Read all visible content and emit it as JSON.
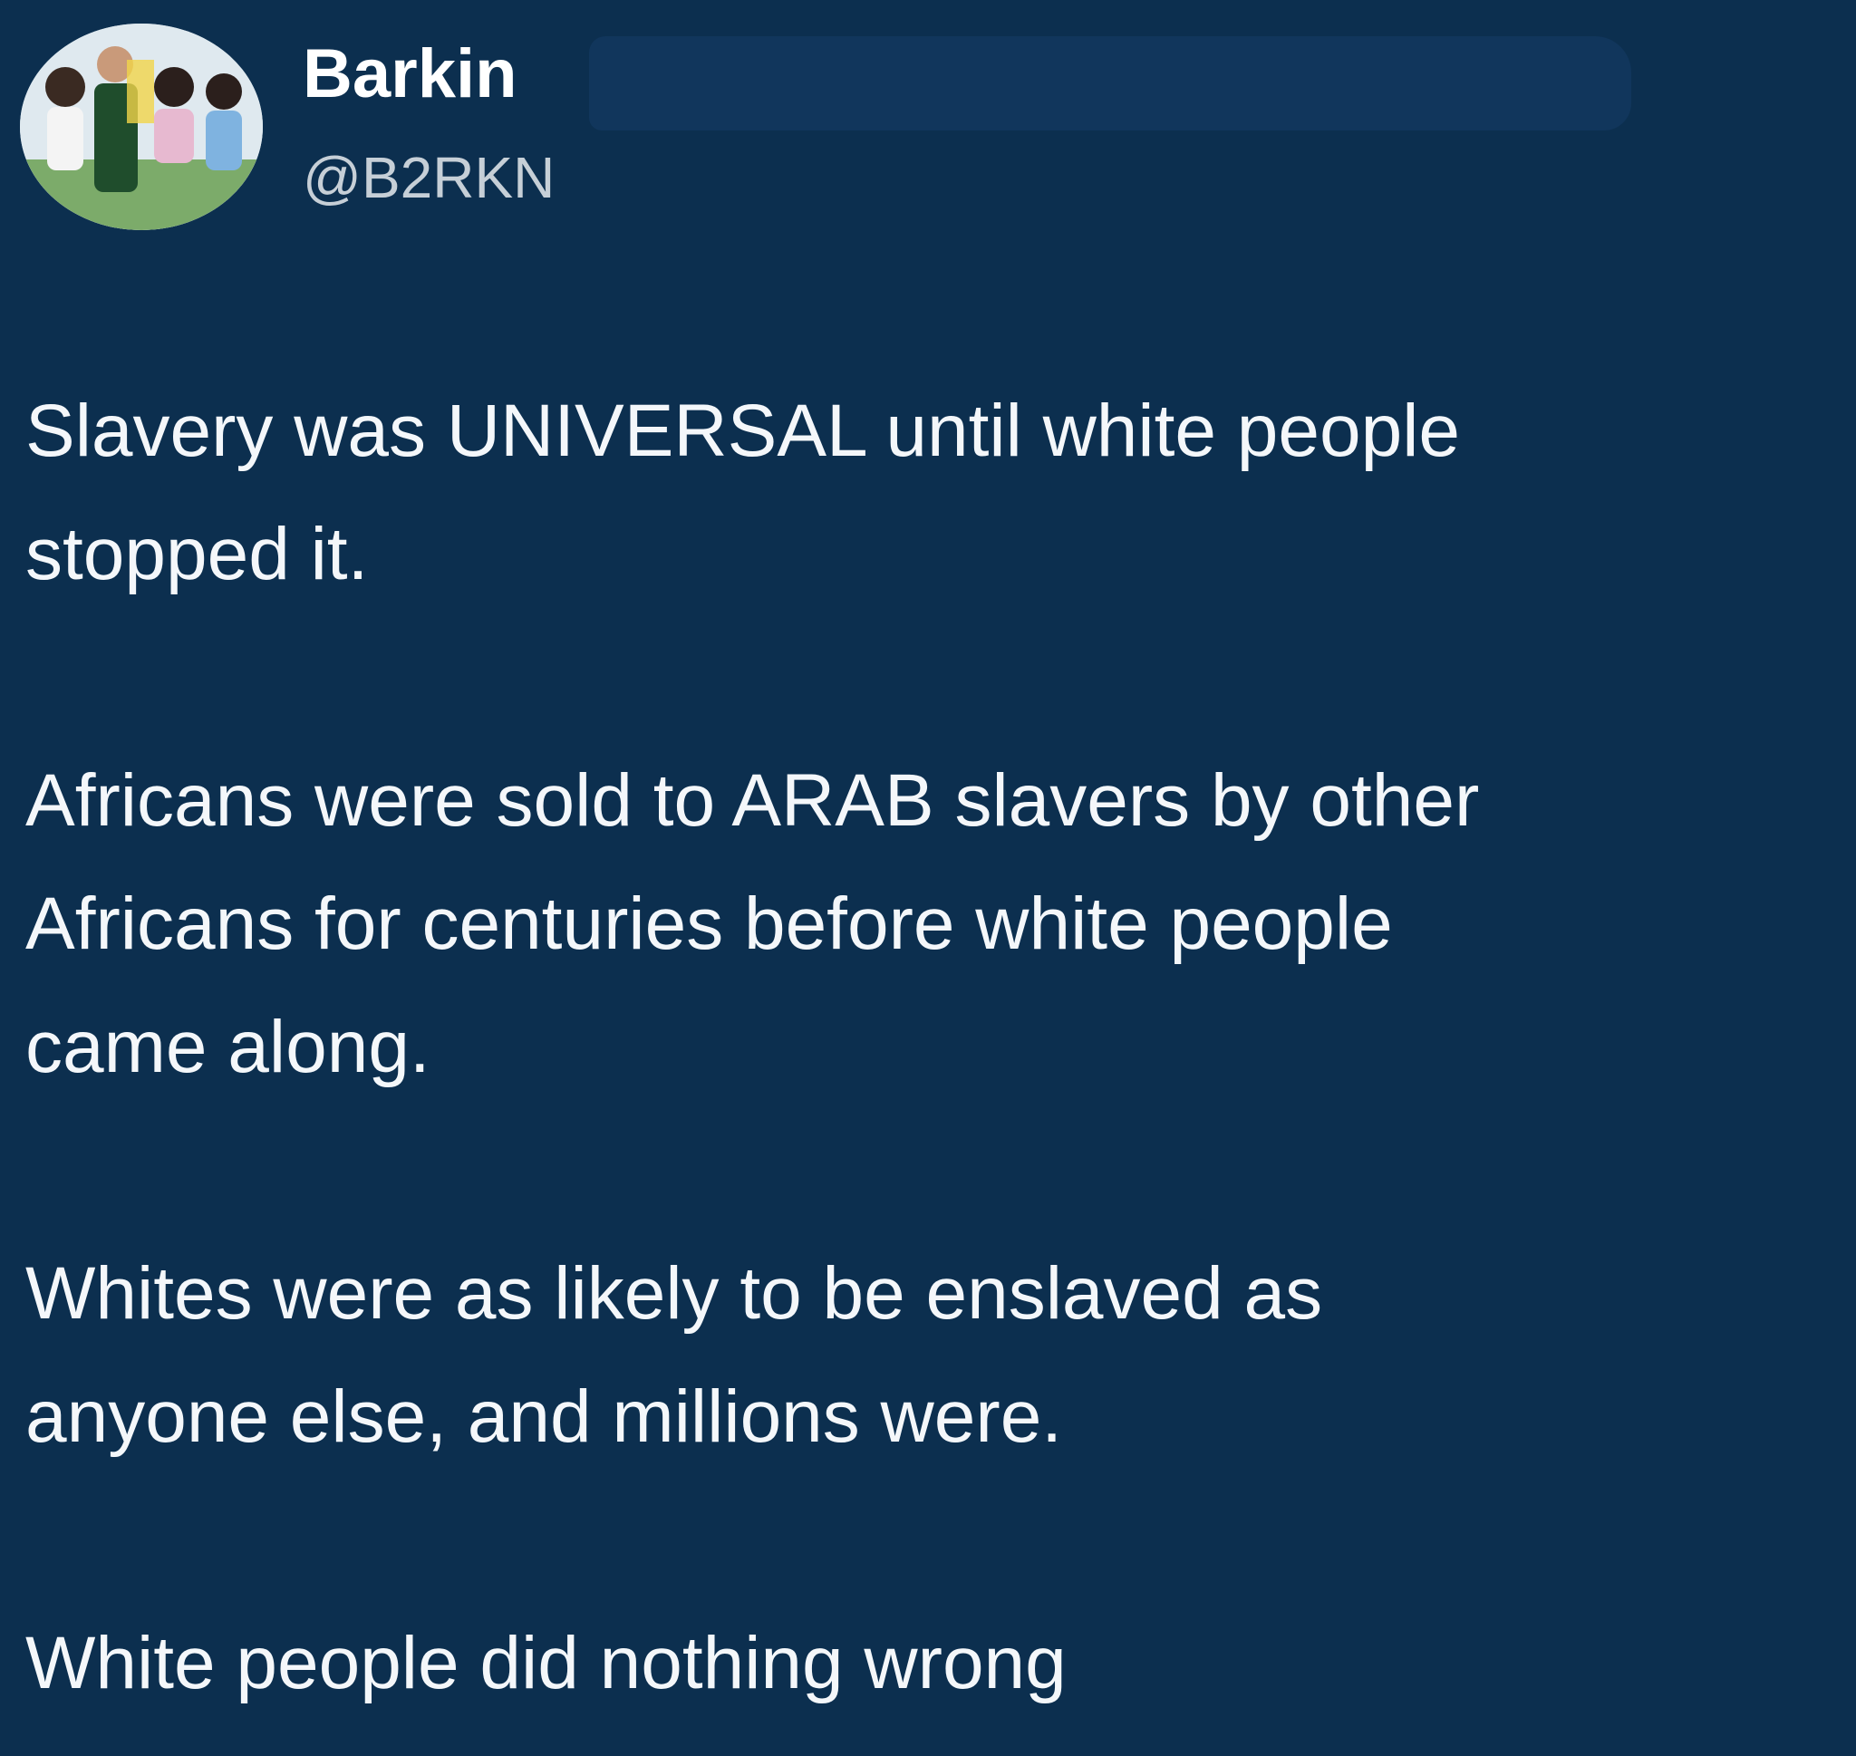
{
  "author": {
    "display_name": "Barkin",
    "handle": "@B2RKN",
    "avatar_icon": "avatar-photo-icon"
  },
  "tweet": {
    "paragraphs": [
      "Slavery was UNIVERSAL until white people\nstopped it.",
      "Africans were sold to ARAB slavers by other\nAfricans for centuries before white people\ncame along.",
      "Whites were as likely to be enslaved as\nanyone else, and millions were.",
      "White people did nothing wrong"
    ]
  },
  "colors": {
    "background": "#0c2f4f",
    "text": "#f4f7fa",
    "handle": "#c6cfd7"
  }
}
